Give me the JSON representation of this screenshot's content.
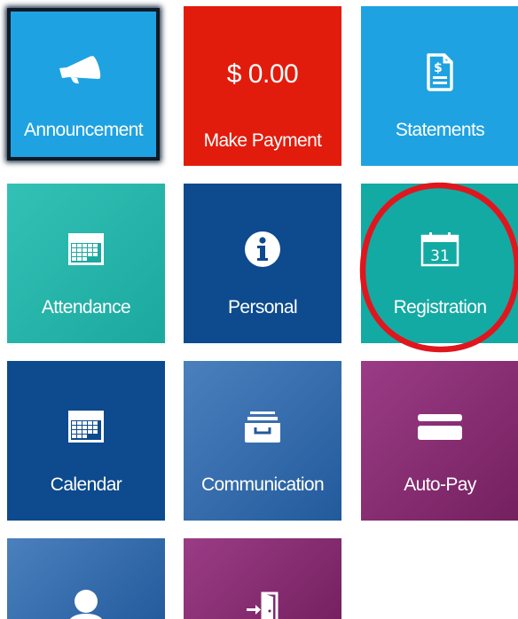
{
  "tiles": {
    "announcement": {
      "label": "Announcement",
      "icon": "megaphone-icon",
      "color": "#1fa2e1",
      "selected": true
    },
    "make_payment": {
      "amount": "$ 0.00",
      "label": "Make Payment",
      "color": "#e21c0c"
    },
    "statements": {
      "label": "Statements",
      "icon": "statement-document-icon",
      "color": "#1fa2e1"
    },
    "attendance": {
      "label": "Attendance",
      "icon": "attendance-calendar-icon",
      "color": "#1ba99f"
    },
    "personal": {
      "label": "Personal",
      "icon": "info-icon",
      "color": "#0d4a8e"
    },
    "registration": {
      "label": "Registration",
      "icon": "calendar-31-icon",
      "icon_text": "31",
      "color": "#13aaa3",
      "annotation": "red-circle-highlight"
    },
    "calendar": {
      "label": "Calendar",
      "icon": "calendar-grid-icon",
      "color": "#0d4a8e"
    },
    "communication": {
      "label": "Communication",
      "icon": "inbox-tray-icon",
      "color": "#225a9c"
    },
    "auto_pay": {
      "label": "Auto-Pay",
      "icon": "credit-card-icon",
      "color": "#74205f"
    },
    "profile": {
      "icon": "user-icon",
      "color": "#225a9c"
    },
    "logout": {
      "icon": "exit-door-icon",
      "color": "#74205f"
    }
  },
  "highlight_color": "#e0161e"
}
